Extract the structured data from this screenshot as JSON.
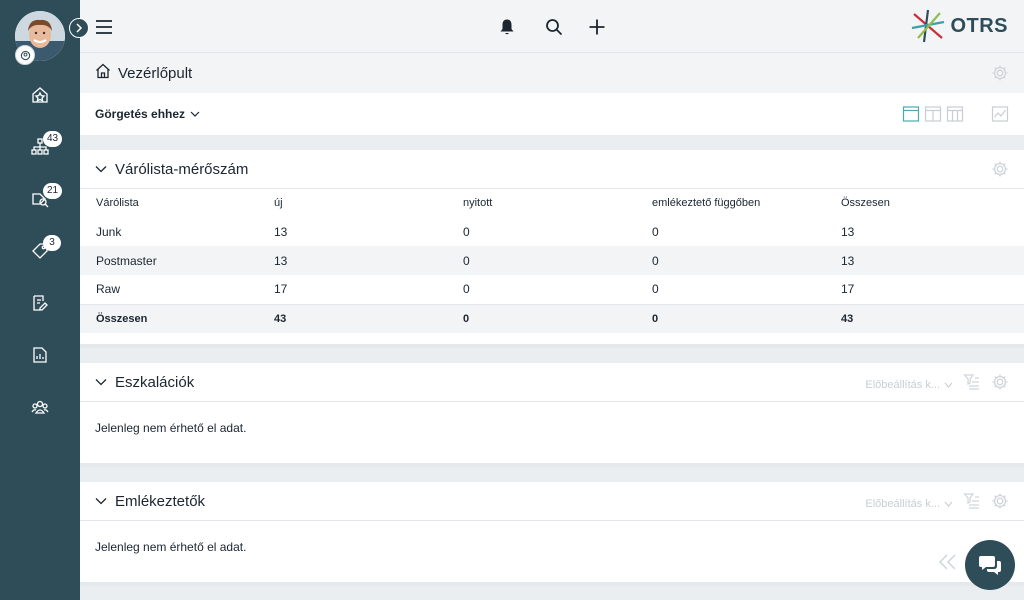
{
  "sidebar": {
    "items": [
      {
        "name": "dashboard",
        "badge": ""
      },
      {
        "name": "queues",
        "badge": "43"
      },
      {
        "name": "search-tickets",
        "badge": "21"
      },
      {
        "name": "tags",
        "badge": "3"
      },
      {
        "name": "new-ticket",
        "badge": ""
      },
      {
        "name": "reports",
        "badge": ""
      },
      {
        "name": "customers",
        "badge": ""
      }
    ]
  },
  "topbar": {
    "logo_text": "OTRS"
  },
  "breadcrumb": {
    "title": "Vezérlőpult"
  },
  "filter": {
    "label": "Görgetés ehhez"
  },
  "queue_widget": {
    "title": "Várólista-mérőszám",
    "columns": [
      "Várólista",
      "új",
      "nyitott",
      "emlékeztető függőben",
      "Összesen"
    ],
    "rows": [
      [
        "Junk",
        "13",
        "0",
        "0",
        "13"
      ],
      [
        "Postmaster",
        "13",
        "0",
        "0",
        "13"
      ],
      [
        "Raw",
        "17",
        "0",
        "0",
        "17"
      ]
    ],
    "total": [
      "Összesen",
      "43",
      "0",
      "0",
      "43"
    ]
  },
  "escalations_widget": {
    "title": "Eszkalációk",
    "preset": "Előbeállítás k...",
    "no_data": "Jelenleg nem érhető el adat."
  },
  "reminders_widget": {
    "title": "Emlékeztetők",
    "preset": "Előbeállítás k...",
    "no_data": "Jelenleg nem érhető el adat."
  }
}
